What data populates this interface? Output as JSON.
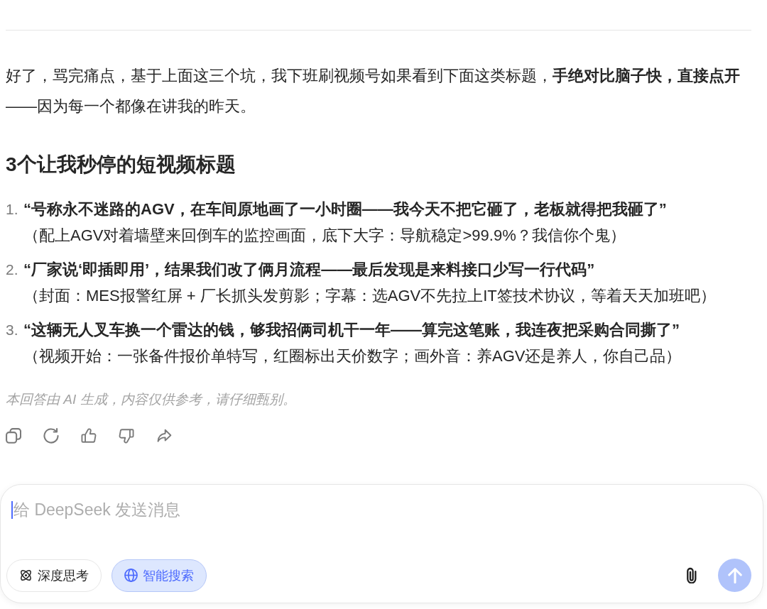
{
  "message": {
    "paragraph": "好了，骂完痛点，基于上面这三个坑，我下班刷视频号如果看到下面这类标题，**手绝对比脑子快，直接点开**——因为每一个都像在讲我的昨天。",
    "heading": "3个让我秒停的短视频标题",
    "items": [
      {
        "number": "1.",
        "title": "“号称永不迷路的AGV，在车间原地画了一小时圈——我今天不把它砸了，老板就得把我砸了”",
        "note": "（配上AGV对着墙壁来回倒车的监控画面，底下大字：导航稳定>99.9%？我信你个鬼）"
      },
      {
        "number": "2.",
        "title": "“厂家说‘即插即用’，结果我们改了俩月流程——最后发现是来料接口少写一行代码”",
        "note": "（封面：MES报警红屏 + 厂长抓头发剪影；字幕：选AGV不先拉上IT签技术协议，等着天天加班吧）"
      },
      {
        "number": "3.",
        "title": "“这辆无人叉车换一个雷达的钱，够我招俩司机干一年——算完这笔账，我连夜把采购合同撕了”",
        "note": "（视频开始：一张备件报价单特写，红圈标出天价数字；画外音：养AGV还是养人，你自己品）"
      }
    ],
    "disclaimer": "本回答由 AI 生成，内容仅供参考，请仔细甄别。"
  },
  "composer": {
    "placeholder": "给 DeepSeek 发送消息",
    "focused": true,
    "toggles": [
      {
        "kind": "think",
        "label": "深度思考",
        "selected": false
      },
      {
        "kind": "search",
        "label": "智能搜索",
        "selected": true
      }
    ],
    "send": {
      "disabled": true
    }
  }
}
